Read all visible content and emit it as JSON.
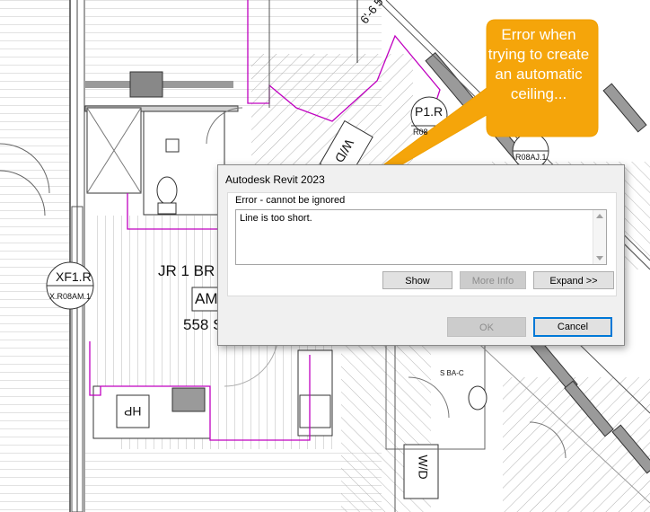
{
  "plan": {
    "room_name": "JR 1 BR -",
    "room_tag": "AM",
    "room_area": "558 S",
    "door_tag_1": "XF1.R",
    "door_tag_1_sub": "X.R08AM.1",
    "door_tag_2": "P1.R",
    "door_tag_2_sub": "R08",
    "door_tag_3_sub": "R08AJ.1",
    "dimension": "6'-6 5",
    "unit_tag": "S BA-C",
    "appliance_hp": "HP",
    "appliance_wd": "W/D",
    "appliance_wd_top": "W/D"
  },
  "dialog": {
    "title": "Autodesk Revit 2023",
    "heading": "Error - cannot be ignored",
    "message": "Line is too short.",
    "buttons": {
      "show": "Show",
      "more_info": "More Info",
      "expand": "Expand >>",
      "ok": "OK",
      "cancel": "Cancel"
    }
  },
  "callout": {
    "text": "Error when trying to create an automatic ceiling...",
    "color": "#f5a50a"
  }
}
